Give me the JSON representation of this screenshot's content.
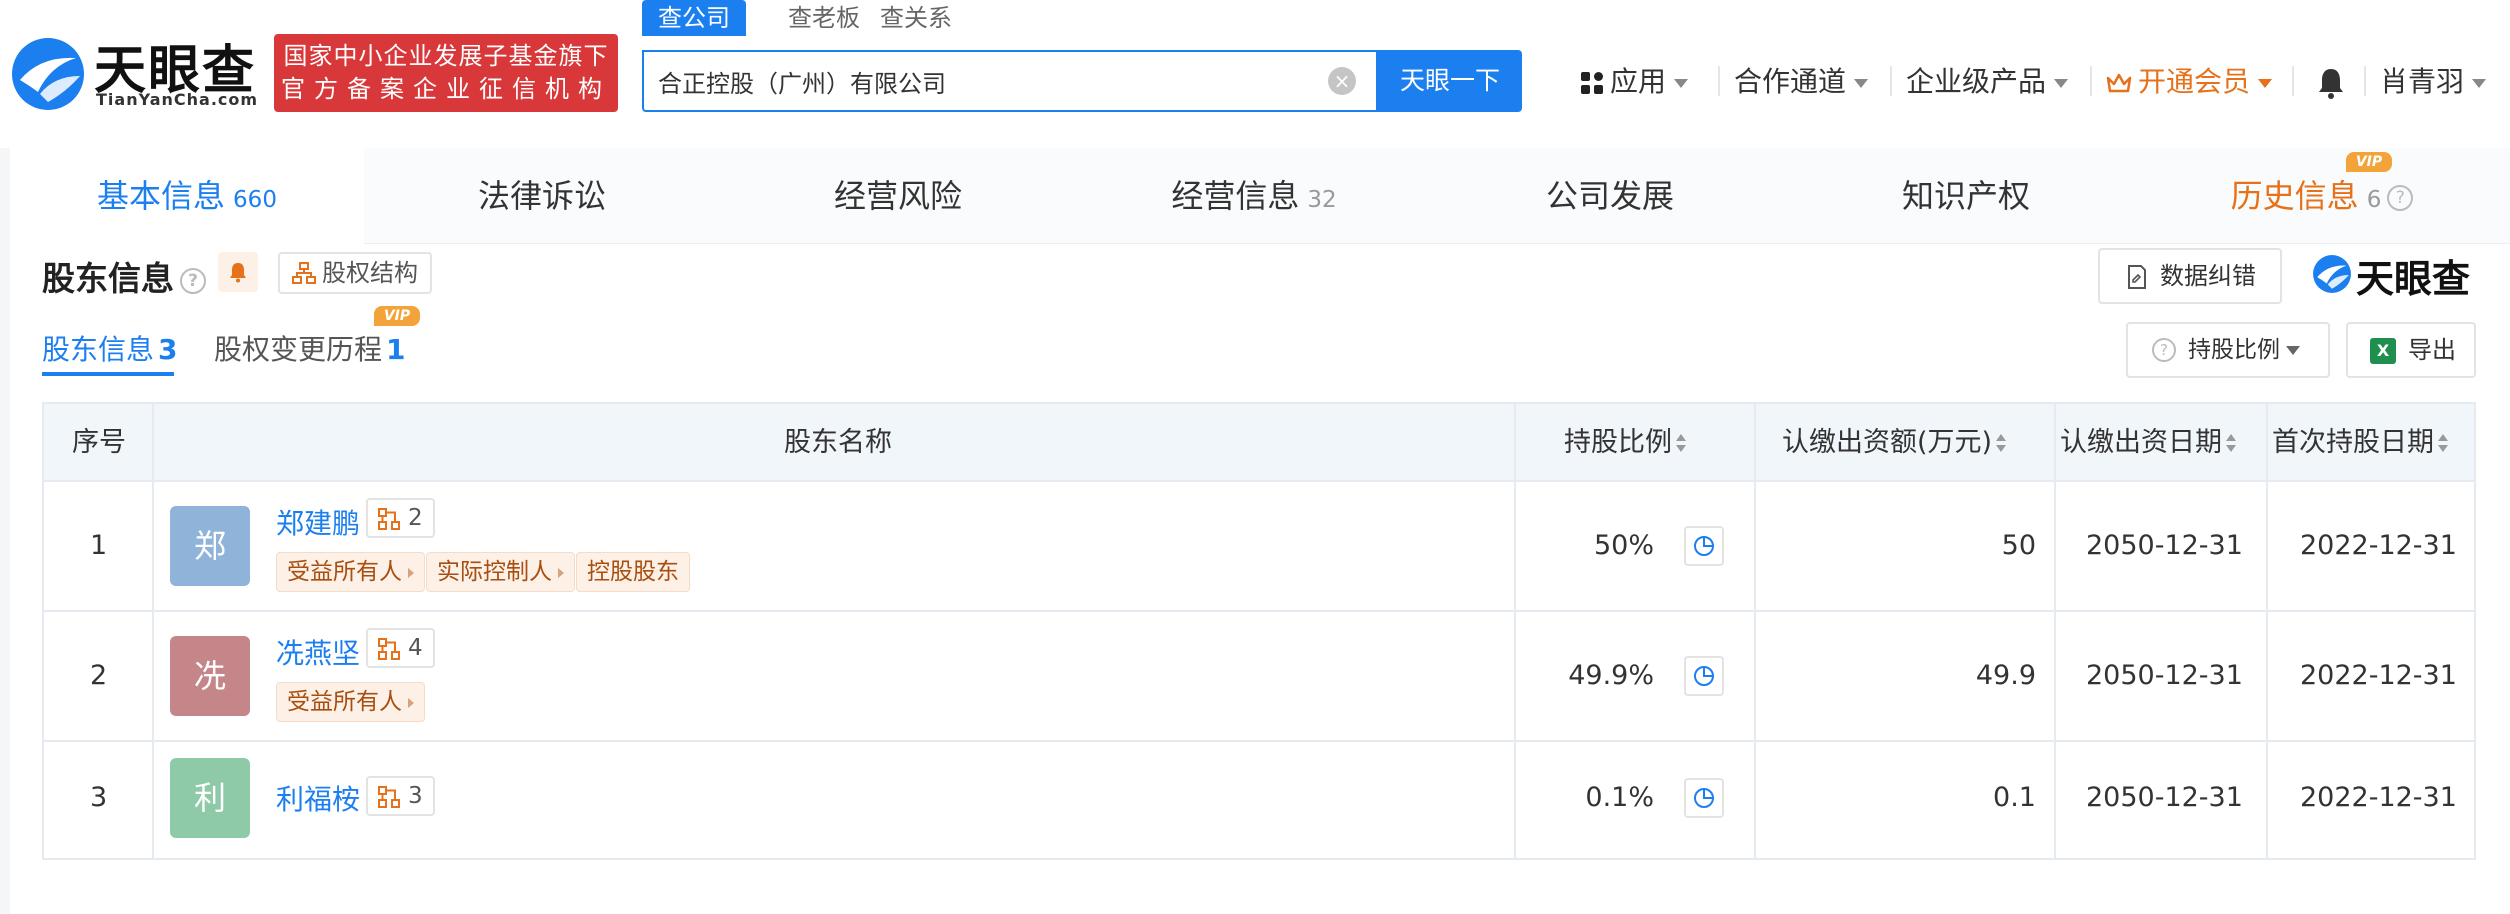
{
  "header": {
    "logo_text": "天眼查",
    "logo_url": "TianYanCha.com",
    "badge_line1": "国家中小企业发展子基金旗下",
    "badge_line2": "官方备案企业征信机构",
    "search_tabs": [
      "查公司",
      "查老板",
      "查关系"
    ],
    "search_value": "合正控股（广州）有限公司",
    "search_button": "天眼一下",
    "nav": {
      "apps": "应用",
      "partner": "合作通道",
      "enterprise": "企业级产品",
      "vip": "开通会员",
      "user": "肖青羽"
    }
  },
  "tabs": [
    {
      "label": "基本信息",
      "count": "660"
    },
    {
      "label": "法律诉讼",
      "count": ""
    },
    {
      "label": "经营风险",
      "count": ""
    },
    {
      "label": "经营信息",
      "count": "32"
    },
    {
      "label": "公司发展",
      "count": ""
    },
    {
      "label": "知识产权",
      "count": ""
    },
    {
      "label": "历史信息",
      "count": "6"
    }
  ],
  "vip_label": "VIP",
  "section": {
    "title": "股东信息",
    "structure_button": "股权结构",
    "report_button": "数据纠错",
    "brand": "天眼查",
    "subtabs": [
      {
        "label": "股东信息",
        "count": "3"
      },
      {
        "label": "股权变更历程",
        "count": "1"
      }
    ],
    "ratio_button": "持股比例",
    "export_button": "导出"
  },
  "table": {
    "headers": {
      "index": "序号",
      "name": "股东名称",
      "ratio": "持股比例",
      "amount": "认缴出资额(万元)",
      "date": "认缴出资日期",
      "first_date": "首次持股日期"
    },
    "rows": [
      {
        "index": "1",
        "avatar": "郑",
        "avatar_color": "#8fb3d9",
        "name": "郑建鹏",
        "links": "2",
        "tags": [
          "受益所有人",
          "实际控制人",
          "控股股东"
        ],
        "ratio": "50%",
        "amount": "50",
        "date": "2050-12-31",
        "first_date": "2022-12-31"
      },
      {
        "index": "2",
        "avatar": "冼",
        "avatar_color": "#c5868a",
        "name": "冼燕坚",
        "links": "4",
        "tags": [
          "受益所有人"
        ],
        "ratio": "49.9%",
        "amount": "49.9",
        "date": "2050-12-31",
        "first_date": "2022-12-31"
      },
      {
        "index": "3",
        "avatar": "利",
        "avatar_color": "#8fcaa8",
        "name": "利福桉",
        "links": "3",
        "tags": [],
        "ratio": "0.1%",
        "amount": "0.1",
        "date": "2050-12-31",
        "first_date": "2022-12-31"
      }
    ]
  }
}
